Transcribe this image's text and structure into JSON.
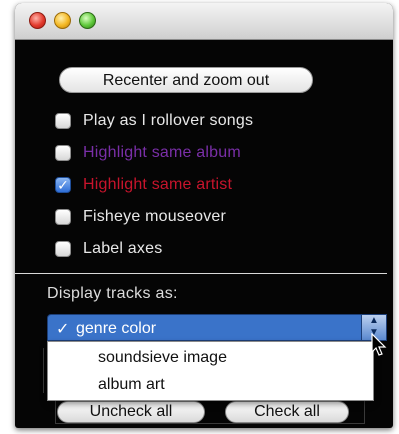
{
  "window": {
    "traffic_lights": [
      "close",
      "minimize",
      "zoom"
    ]
  },
  "recenter_button": "Recenter and zoom out",
  "options": [
    {
      "label": "Play as I rollover songs",
      "checked": false,
      "color": "#e8e8e8"
    },
    {
      "label": "Highlight same album",
      "checked": false,
      "color": "#7a2fa8"
    },
    {
      "label": "Highlight same artist",
      "checked": true,
      "color": "#c8142c"
    },
    {
      "label": "Fisheye mouseover",
      "checked": false,
      "color": "#e8e8e8"
    },
    {
      "label": "Label axes",
      "checked": false,
      "color": "#e8e8e8"
    }
  ],
  "display_label": "Display tracks as:",
  "display_select": {
    "selected": "genre color",
    "options": [
      "genre color",
      "soundsieve image",
      "album art"
    ],
    "check_mark": "✓"
  },
  "bottom_buttons": {
    "uncheck_all": "Uncheck all",
    "check_all": "Check all"
  },
  "colors": {
    "window_bg": "#050505",
    "select_highlight": "#3a73c9"
  }
}
